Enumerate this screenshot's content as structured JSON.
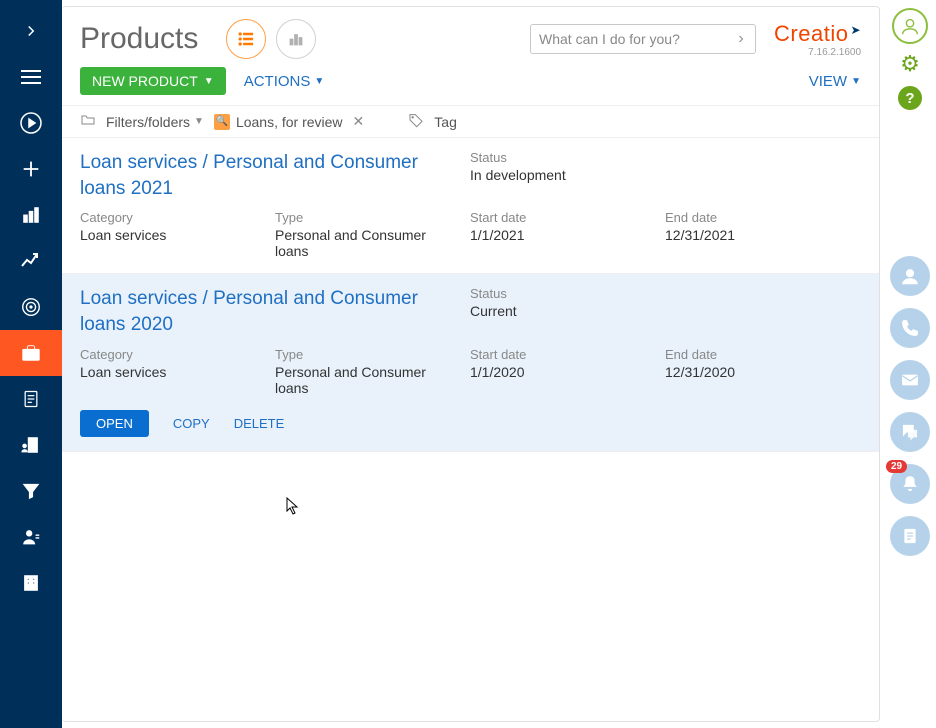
{
  "header": {
    "title": "Products",
    "search_placeholder": "What can I do for you?",
    "logo_text": "Creatio",
    "version": "7.16.2.1600"
  },
  "toolbar": {
    "new_product": "NEW PRODUCT",
    "actions": "ACTIONS",
    "view": "VIEW"
  },
  "filterbar": {
    "filters_label": "Filters/folders",
    "chip_label": "Loans, for review",
    "tag_label": "Tag"
  },
  "labels": {
    "status": "Status",
    "category": "Category",
    "type": "Type",
    "start_date": "Start date",
    "end_date": "End date"
  },
  "row_actions": {
    "open": "OPEN",
    "copy": "COPY",
    "delete": "DELETE"
  },
  "rows": [
    {
      "title": "Loan services / Personal and Consumer loans 2021",
      "status": "In development",
      "category": "Loan services",
      "type": "Personal and Consumer loans",
      "start_date": "1/1/2021",
      "end_date": "12/31/2021"
    },
    {
      "title": "Loan services / Personal and Consumer loans 2020",
      "status": "Current",
      "category": "Loan services",
      "type": "Personal and Consumer loans",
      "start_date": "1/1/2020",
      "end_date": "12/31/2020"
    }
  ],
  "rail": {
    "notification_count": "29"
  }
}
